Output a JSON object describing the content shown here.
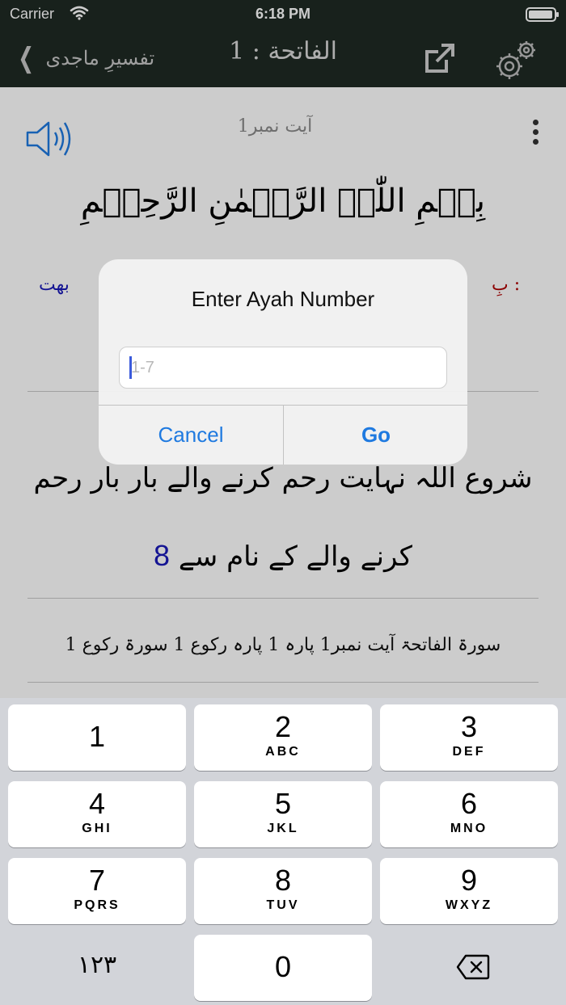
{
  "status_bar": {
    "carrier": "Carrier",
    "time": "6:18 PM",
    "battery_level": 0.95
  },
  "nav": {
    "back_label": "تفسیرِ ماجدی",
    "title": "الفاتحة : 1"
  },
  "content": {
    "ayah_number_label": "آیت نمبر1",
    "arabic_verse": "بِسۡمِ اللّٰہِ الرَّحۡمٰنِ الرَّحِیۡمِ",
    "word_translation_left": "بهت",
    "word_translation_right": "بِ :",
    "translation_text": "شروع اللہ نہایت رحم کرنے والے بار بار رحم کرنے والے کے نام سے",
    "footnote_number": "8",
    "meta_line": "سورۃ الفاتحۃ آیت نمبر1   پارہ 1 پارہ رکوع 1 سورۃ رکوع 1"
  },
  "alert": {
    "title": "Enter Ayah Number",
    "input_placeholder": "1-7",
    "input_value": "",
    "cancel_label": "Cancel",
    "go_label": "Go"
  },
  "keyboard": {
    "keys": [
      {
        "num": "1",
        "letters": ""
      },
      {
        "num": "2",
        "letters": "ABC"
      },
      {
        "num": "3",
        "letters": "DEF"
      },
      {
        "num": "4",
        "letters": "GHI"
      },
      {
        "num": "5",
        "letters": "JKL"
      },
      {
        "num": "6",
        "letters": "MNO"
      },
      {
        "num": "7",
        "letters": "PQRS"
      },
      {
        "num": "8",
        "letters": "TUV"
      },
      {
        "num": "9",
        "letters": "WXYZ"
      },
      {
        "num": "0",
        "letters": ""
      }
    ],
    "symbols_label": "١٢٣"
  },
  "colors": {
    "nav_background": "#1f2a24",
    "accent_blue": "#1f7ae0",
    "footnote_blue": "#1a1ab8",
    "word_red": "#b00000"
  }
}
